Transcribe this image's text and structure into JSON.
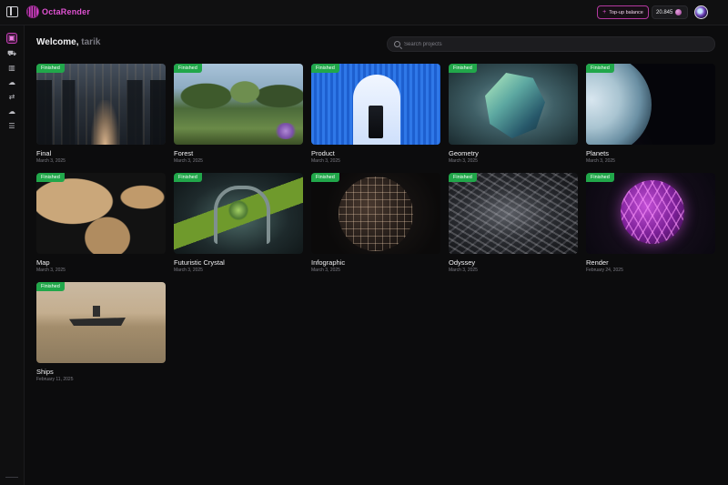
{
  "app": {
    "name": "OctaRender",
    "brand_color": "#e052d2",
    "topup_label": "Top-up balance",
    "balance": "20.845"
  },
  "sidebar": {
    "items": [
      {
        "icon": "folder-icon",
        "active": true
      },
      {
        "icon": "cart-icon",
        "active": false
      },
      {
        "icon": "building-icon",
        "active": false
      },
      {
        "icon": "cloud-icon",
        "active": false
      },
      {
        "icon": "transfer-icon",
        "active": false
      },
      {
        "icon": "cloud-sync-icon",
        "active": false
      },
      {
        "icon": "list-settings-icon",
        "active": false
      }
    ]
  },
  "main": {
    "welcome": "Welcome,",
    "user": "tarik",
    "search_placeholder": "Search projects",
    "status_label": "Finished",
    "status_color": "#21a74a",
    "projects": [
      {
        "title": "Final",
        "date": "March 3, 2025"
      },
      {
        "title": "Forest",
        "date": "March 3, 2025"
      },
      {
        "title": "Product",
        "date": "March 3, 2025"
      },
      {
        "title": "Geometry",
        "date": "March 3, 2025"
      },
      {
        "title": "Planets",
        "date": "March 3, 2025"
      },
      {
        "title": "Map",
        "date": "March 3, 2025"
      },
      {
        "title": "Futuristic Crystal",
        "date": "March 3, 2025"
      },
      {
        "title": "Infographic",
        "date": "March 3, 2025"
      },
      {
        "title": "Odyssey",
        "date": "March 3, 2025"
      },
      {
        "title": "Render",
        "date": "February 24, 2025"
      },
      {
        "title": "Ships",
        "date": "February 11, 2025"
      }
    ]
  }
}
